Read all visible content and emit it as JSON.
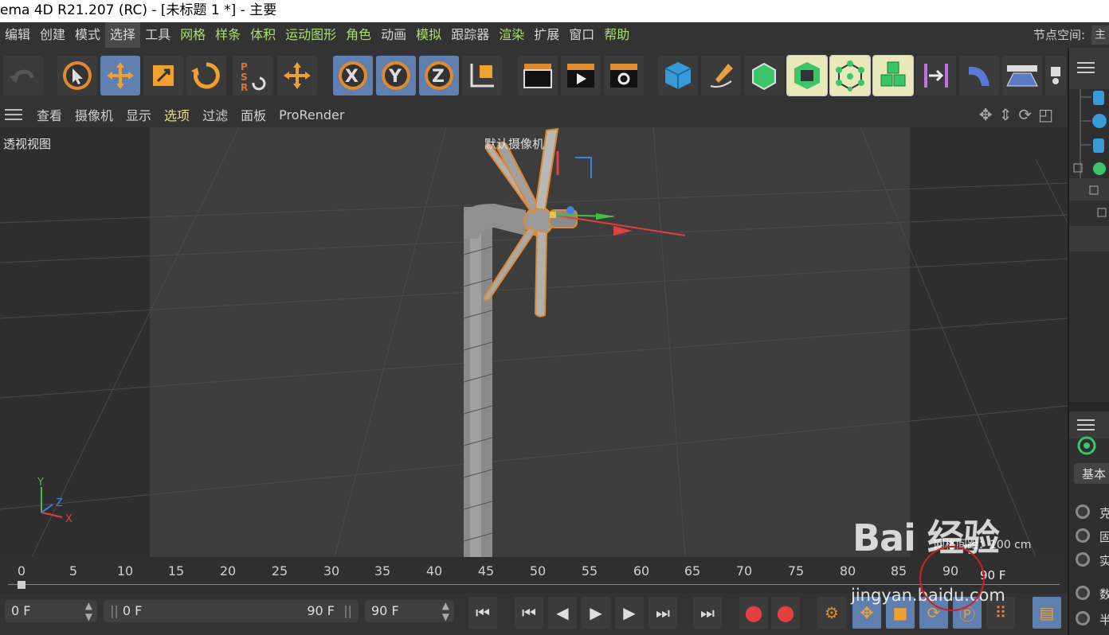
{
  "window": {
    "title": "ema 4D R21.207 (RC) - [未标题 1 *] - 主要"
  },
  "menu": {
    "items": [
      "编辑",
      "创建",
      "模式",
      "选择",
      "工具",
      "网格",
      "样条",
      "体积",
      "运动图形",
      "角色",
      "动画",
      "模拟",
      "跟踪器",
      "渲染",
      "扩展",
      "窗口",
      "帮助"
    ],
    "active": "选择",
    "node_space_label": "节点空间:",
    "node_space_value": "主"
  },
  "toolbar": {
    "icons": [
      "undo-icon",
      "select-cursor-icon",
      "move-icon",
      "scale-icon",
      "rotate-icon",
      "psr-icon",
      "move-tool-icon",
      "x-axis-icon",
      "y-axis-icon",
      "z-axis-icon",
      "world-coord-icon",
      "render-view-icon",
      "render-picture-icon",
      "render-settings-icon",
      "cube-icon",
      "pen-icon",
      "subdivision-icon",
      "extrude-icon",
      "cloner-icon",
      "mograph-cubes-icon",
      "deformer-icon",
      "spline-deform-icon",
      "floor-icon",
      "camera-icon"
    ]
  },
  "viewport_menu": {
    "items": [
      "查看",
      "摄像机",
      "显示",
      "选项",
      "过滤",
      "面板",
      "ProRender"
    ],
    "active": "选项"
  },
  "viewport": {
    "name": "透视视图",
    "camera": "默认摄像机",
    "grid_spacing": "网格间距：100 cm",
    "axis_labels": {
      "y": "Y",
      "z": "Z",
      "x": "X"
    }
  },
  "timeline": {
    "ticks": [
      "0",
      "5",
      "10",
      "15",
      "20",
      "25",
      "30",
      "35",
      "40",
      "45",
      "50",
      "55",
      "60",
      "65",
      "70",
      "75",
      "80",
      "85",
      "90"
    ],
    "current_frame": "90 F"
  },
  "playback": {
    "start_field": "0 F",
    "range_start": "0 F",
    "range_end": "90 F",
    "end_field": "90 F"
  },
  "right_panel": {
    "attr_tab": "基本",
    "labels": [
      "克",
      "固",
      "实",
      "数",
      "半"
    ]
  },
  "watermark": {
    "brand": "Bai 经验",
    "url": "jingyan.baidu.com"
  },
  "colors": {
    "accent_blue": "#5e7fb0",
    "x_axis": "#e04040",
    "y_axis": "#40c040",
    "z_axis": "#4080e0",
    "selection": "#e08a30"
  }
}
